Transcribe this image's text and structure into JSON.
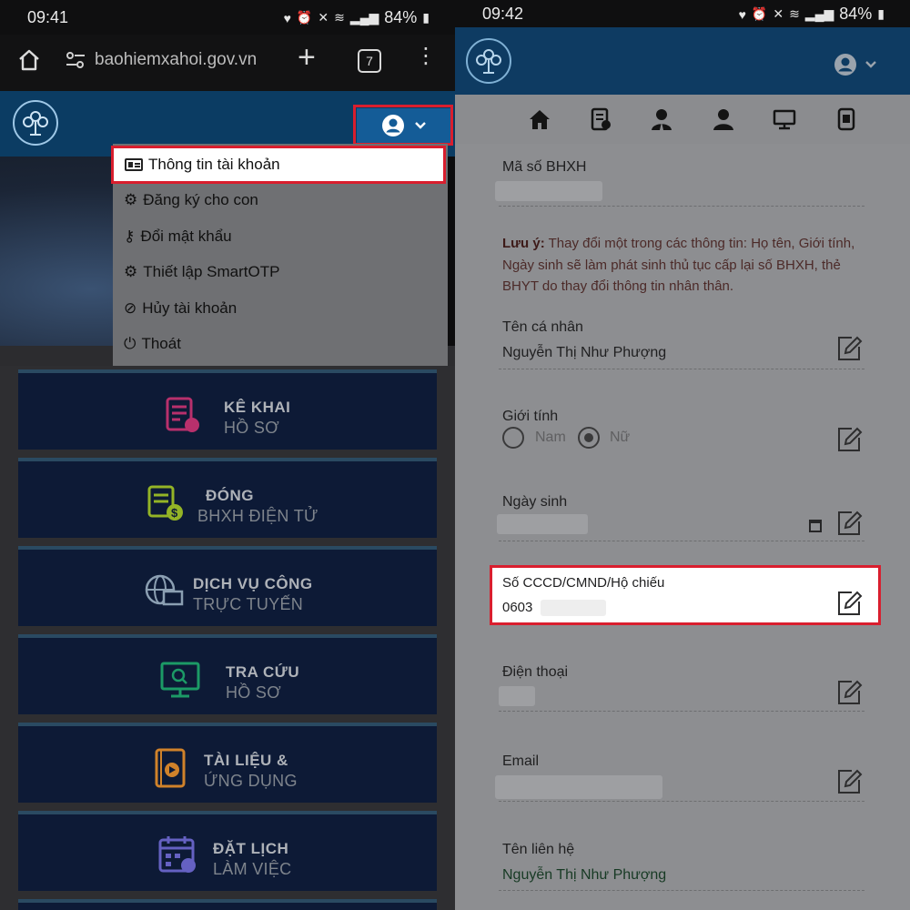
{
  "left": {
    "status": {
      "time": "09:41",
      "battery": "84%"
    },
    "browser": {
      "url": "baohiemxahoi.gov.vn",
      "tab_count": "7"
    },
    "account_menu": {
      "items": [
        {
          "label": "Thông tin tài khoản",
          "icon": "id-card-icon",
          "highlighted": true
        },
        {
          "label": "Đăng ký cho con",
          "icon": "gear-icon"
        },
        {
          "label": "Đổi mật khẩu",
          "icon": "key-icon"
        },
        {
          "label": "Thiết lập SmartOTP",
          "icon": "gear-icon"
        },
        {
          "label": "Hủy tài khoản",
          "icon": "ban-icon"
        },
        {
          "label": "Thoát",
          "icon": "power-icon"
        }
      ]
    },
    "tiles": [
      {
        "line1": "KÊ KHAI",
        "line2": "HỒ SƠ",
        "icon": "document-edit-icon",
        "color": "#c0306f"
      },
      {
        "line1": "ĐÓNG",
        "line2": "BHXH ĐIỆN TỬ",
        "icon": "invoice-dollar-icon",
        "color": "#9bbf28"
      },
      {
        "line1": "DỊCH VỤ CÔNG",
        "line2": "TRỰC TUYẾN",
        "icon": "globe-monitor-icon",
        "color": "#8da0b4"
      },
      {
        "line1": "TRA CỨU",
        "line2": "HỒ SƠ",
        "icon": "monitor-search-icon",
        "color": "#1fa06a"
      },
      {
        "line1": "TÀI LIỆU &",
        "line2": "ỨNG DỤNG",
        "icon": "media-book-icon",
        "color": "#d8862a"
      },
      {
        "line1": "ĐẶT LỊCH",
        "line2": "LÀM VIỆC",
        "icon": "calendar-icon",
        "color": "#6a66c9"
      }
    ]
  },
  "right": {
    "status": {
      "time": "09:42",
      "battery": "84%"
    },
    "nav_icons": [
      "home-icon",
      "document-icon",
      "user-tie-icon",
      "user-icon",
      "monitor-icon",
      "mobile-icon"
    ],
    "fields": {
      "bhxh_label": "Mã số BHXH",
      "note_prefix": "Lưu ý:",
      "note_text": " Thay đổi một trong các thông tin: Họ tên, Giới tính, Ngày sinh sẽ làm phát sinh thủ tục cấp lại số BHXH, thẻ BHYT do thay đổi thông tin nhân thân.",
      "name_label": "Tên cá nhân",
      "name_value": "Nguyễn Thị Như Phượng",
      "gender_label": "Giới tính",
      "gender_male": "Nam",
      "gender_female": "Nữ",
      "dob_label": "Ngày sinh",
      "id_label": "Số CCCD/CMND/Hộ chiếu",
      "id_value": "0603",
      "phone_label": "Điện thoại",
      "email_label": "Email",
      "contact_label": "Tên liên hệ",
      "contact_value": "Nguyễn Thị Như Phượng"
    }
  }
}
